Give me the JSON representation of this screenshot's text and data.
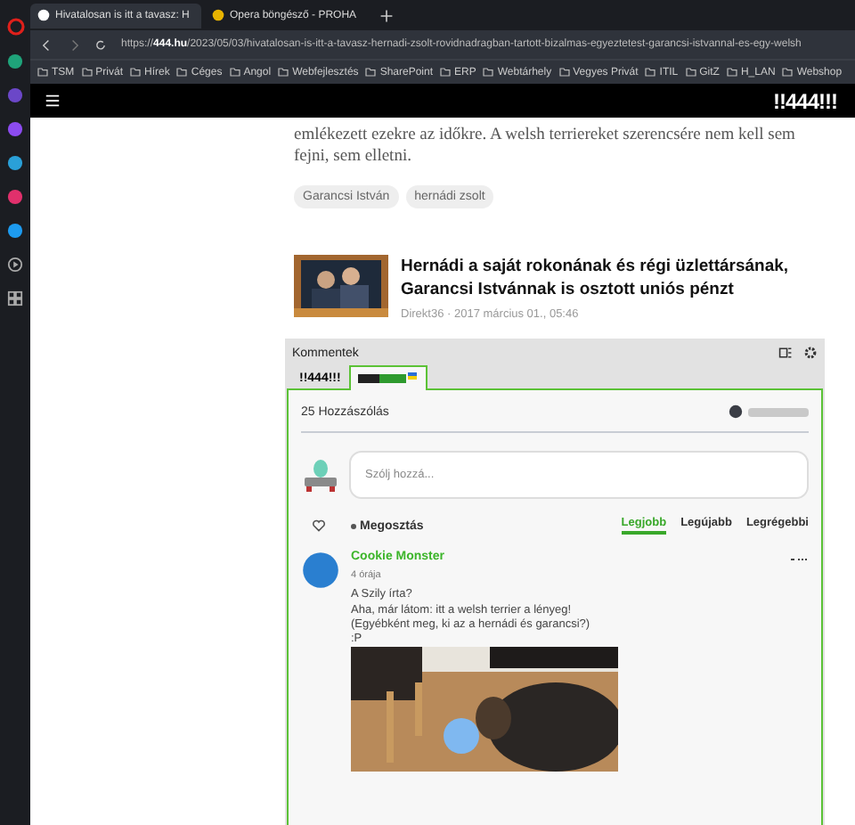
{
  "browser": {
    "tabs": [
      {
        "title": "Hivatalosan is itt a tavasz: H",
        "selected": true
      },
      {
        "title": "Opera böngésző - PROHA",
        "selected": false
      }
    ],
    "url_host": "444.hu",
    "url_scheme": "https://",
    "url_path": "/2023/05/03/hivatalosan-is-itt-a-tavasz-hernadi-zsolt-rovidnadragban-tartott-bizalmas-egyeztetest-garancsi-istvannal-es-egy-welsh",
    "bookmarks": [
      "TSM",
      "Privát",
      "Hírek",
      "Céges",
      "Angol",
      "Webfejlesztés",
      "SharePoint",
      "ERP",
      "Webtárhely",
      "Vegyes Privát",
      "ITIL",
      "GitZ",
      "H_LAN",
      "Webshop"
    ]
  },
  "site_header": {
    "logo": "!!444!!!"
  },
  "article": {
    "paragraph": "emlékezett ezekre az időkre. A welsh terriereket szerencsére nem kell sem fejni, sem elletni.",
    "tags": [
      "Garancsi István",
      "hernádi zsolt"
    ],
    "related": {
      "title": "Hernádi a saját rokonának és régi üzlettársának, Garancsi Istvánnak is osztott uniós pénzt",
      "meta": "Direkt36 · 2017 március 01., 05:46"
    }
  },
  "comments": {
    "title": "Kommentek",
    "tabs": [
      {
        "label": "!!444!!!",
        "kind": "text",
        "selected": false
      },
      {
        "kind": "logo",
        "selected": true
      }
    ],
    "count": "25 Hozzászólás",
    "input_placeholder": "Szólj hozzá...",
    "share": "Megosztás",
    "sort": [
      {
        "label": "Legjobb",
        "selected": true
      },
      {
        "label": "Legújabb",
        "selected": false
      },
      {
        "label": "Legrégebbi",
        "selected": false
      }
    ],
    "comment": {
      "author": "Cookie Monster",
      "time": "4 órája",
      "lines": [
        "A Szily írta?",
        "Aha, már látom: itt a welsh terrier a lényeg!",
        "(Egyébként meg, ki az a hernádi és garancsi?)",
        ":P"
      ]
    }
  }
}
